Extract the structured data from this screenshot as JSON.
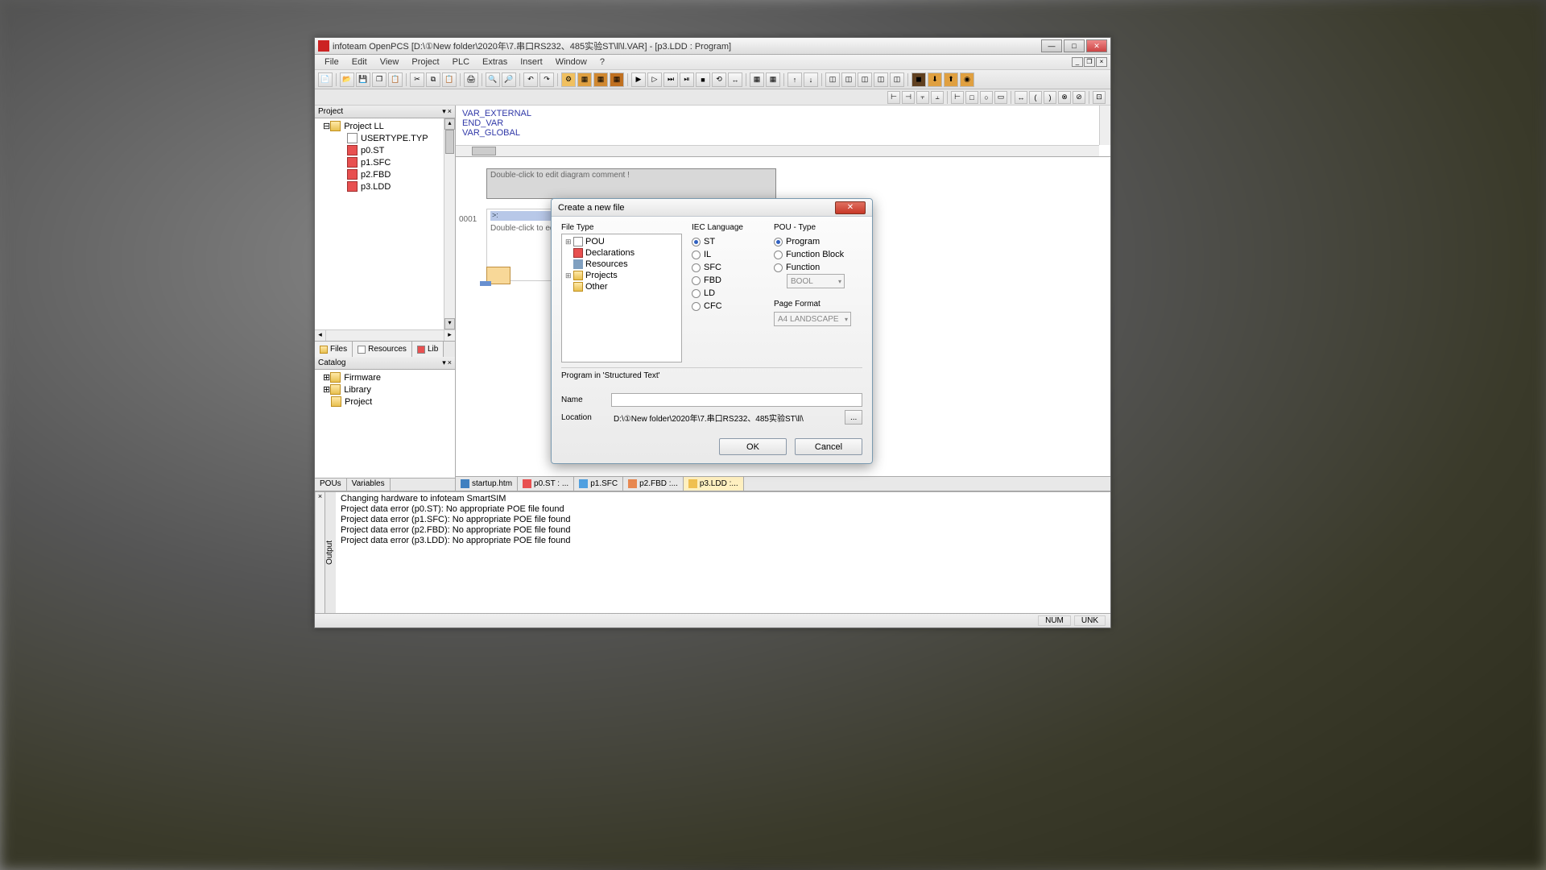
{
  "titlebar": {
    "text": "infoteam OpenPCS [D:\\①New folder\\2020年\\7.串口RS232、485实验ST\\ll\\l.VAR]  - [p3.LDD : Program]"
  },
  "menu": {
    "items": [
      "File",
      "Edit",
      "View",
      "Project",
      "PLC",
      "Extras",
      "Insert",
      "Window",
      "?"
    ]
  },
  "project_panel": {
    "title": "Project",
    "root": "Project LL",
    "files": [
      "USERTYPE.TYP",
      "p0.ST",
      "p1.SFC",
      "p2.FBD",
      "p3.LDD"
    ],
    "tabs": [
      "Files",
      "Resources",
      "Lib"
    ]
  },
  "catalog_panel": {
    "title": "Catalog",
    "items": [
      "Firmware",
      "Library",
      "Project"
    ],
    "bottom_tabs": [
      "POUs",
      "Variables"
    ]
  },
  "editor": {
    "code_lines": [
      "VAR_EXTERNAL",
      "END_VAR",
      "VAR_GLOBAL"
    ],
    "comment_hint": "Double-click to edit diagram comment !",
    "row_comment": "Double-click to ed",
    "row_num": "0001",
    "cursor_text": ">:",
    "tabs": [
      {
        "label": "startup.htm"
      },
      {
        "label": "p0.ST : ..."
      },
      {
        "label": "p1.SFC"
      },
      {
        "label": "p2.FBD :..."
      },
      {
        "label": "p3.LDD :..."
      }
    ]
  },
  "output": {
    "label": "Output",
    "lines": [
      "Changing hardware to infoteam SmartSIM",
      "Project data error (p0.ST): No appropriate POE file found",
      "Project data error (p1.SFC): No appropriate POE file found",
      "Project data error (p2.FBD): No appropriate POE file found",
      "Project data error (p3.LDD): No appropriate POE file found"
    ]
  },
  "status": {
    "num": "NUM",
    "unk": "UNK"
  },
  "dialog": {
    "title": "Create a new file",
    "filetype_label": "File Type",
    "filetypes": [
      "POU",
      "Declarations",
      "Resources",
      "Projects",
      "Other"
    ],
    "iec_label": "IEC Language",
    "iec_langs": [
      "ST",
      "IL",
      "SFC",
      "FBD",
      "LD",
      "CFC"
    ],
    "iec_selected": "ST",
    "pou_label": "POU - Type",
    "pou_types": [
      "Program",
      "Function Block",
      "Function"
    ],
    "pou_selected": "Program",
    "bool_select": "BOOL",
    "page_format_label": "Page Format",
    "page_format": "A4 LANDSCAPE",
    "description": "Program in 'Structured Text'",
    "name_label": "Name",
    "name_value": "",
    "location_label": "Location",
    "location_value": "D:\\①New folder\\2020年\\7.串口RS232、485实验ST\\ll\\",
    "ok": "OK",
    "cancel": "Cancel"
  }
}
